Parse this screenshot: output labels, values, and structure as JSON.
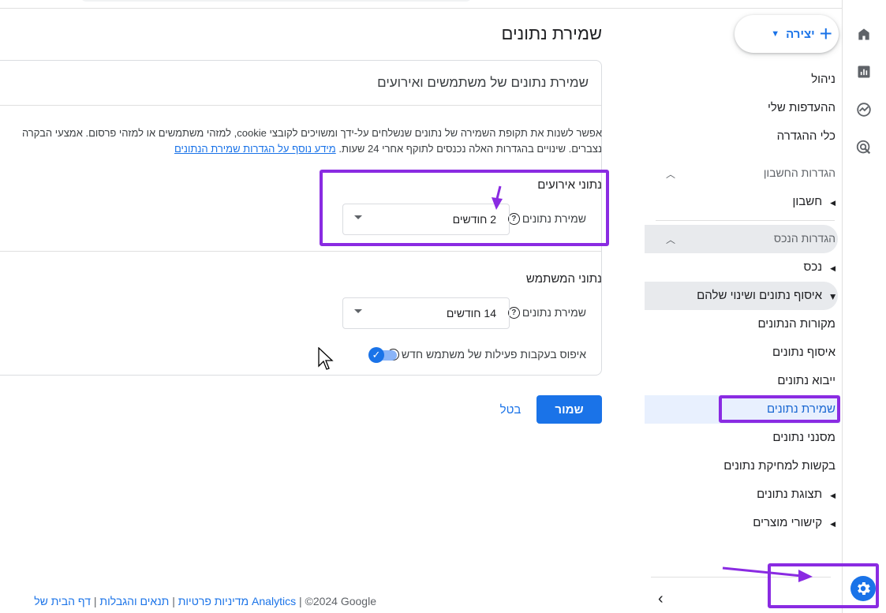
{
  "nav": {
    "create_label": "יצירה",
    "items_top": [
      "ניהול",
      "ההעדפות שלי",
      "כלי ההגדרה"
    ],
    "account_section": "הגדרות החשבון",
    "account_item": "חשבון",
    "property_section": "הגדרות הנכס",
    "property_item": "נכס",
    "collection_item": "איסוף נתונים ושינוי שלהם",
    "sub_items": [
      "מקורות הנתונים",
      "איסוף נתונים",
      "ייבוא נתונים",
      "שמירת נתונים",
      "מסנני נתונים",
      "בקשות למחיקת נתונים"
    ],
    "display_item": "תצוגת נתונים",
    "product_links_item": "קישורי מוצרים"
  },
  "main": {
    "page_title": "שמירת נתונים",
    "card_title": "שמירת נתונים של משתמשים ואירועים",
    "desc_line1": "אפשר לשנות את תקופת השמירה של נתונים שנשלחים על-ידך ומשויכים לקובצי cookie, למזהי משתמשים או למזהי פרסום. אמצעי הבקרה",
    "desc_line2_text": "נצברים. שינויים בהגדרות האלה נכנסים לתוקף אחרי 24 שעות.",
    "desc_link": "מידע נוסף על הגדרות שמירת הנתונים",
    "event_section": "נתוני אירועים",
    "event_label": "שמירת נתונים",
    "event_value": "2 חודשים",
    "user_section": "נתוני המשתמש",
    "user_label": "שמירת נתונים",
    "user_value": "14 חודשים",
    "reset_label": "איפוס בעקבות פעילות של משתמש חדש",
    "reset_enabled": true,
    "save_label": "שמור",
    "cancel_label": "בטל"
  },
  "footer": {
    "copyright": "©2024 Google",
    "link1": "דף הבית של Analytics",
    "link2": "תנאים והגבלות",
    "link3": "מדיניות פרטיות"
  },
  "colors": {
    "accent": "#1a73e8",
    "annotation": "#8a2be2"
  }
}
